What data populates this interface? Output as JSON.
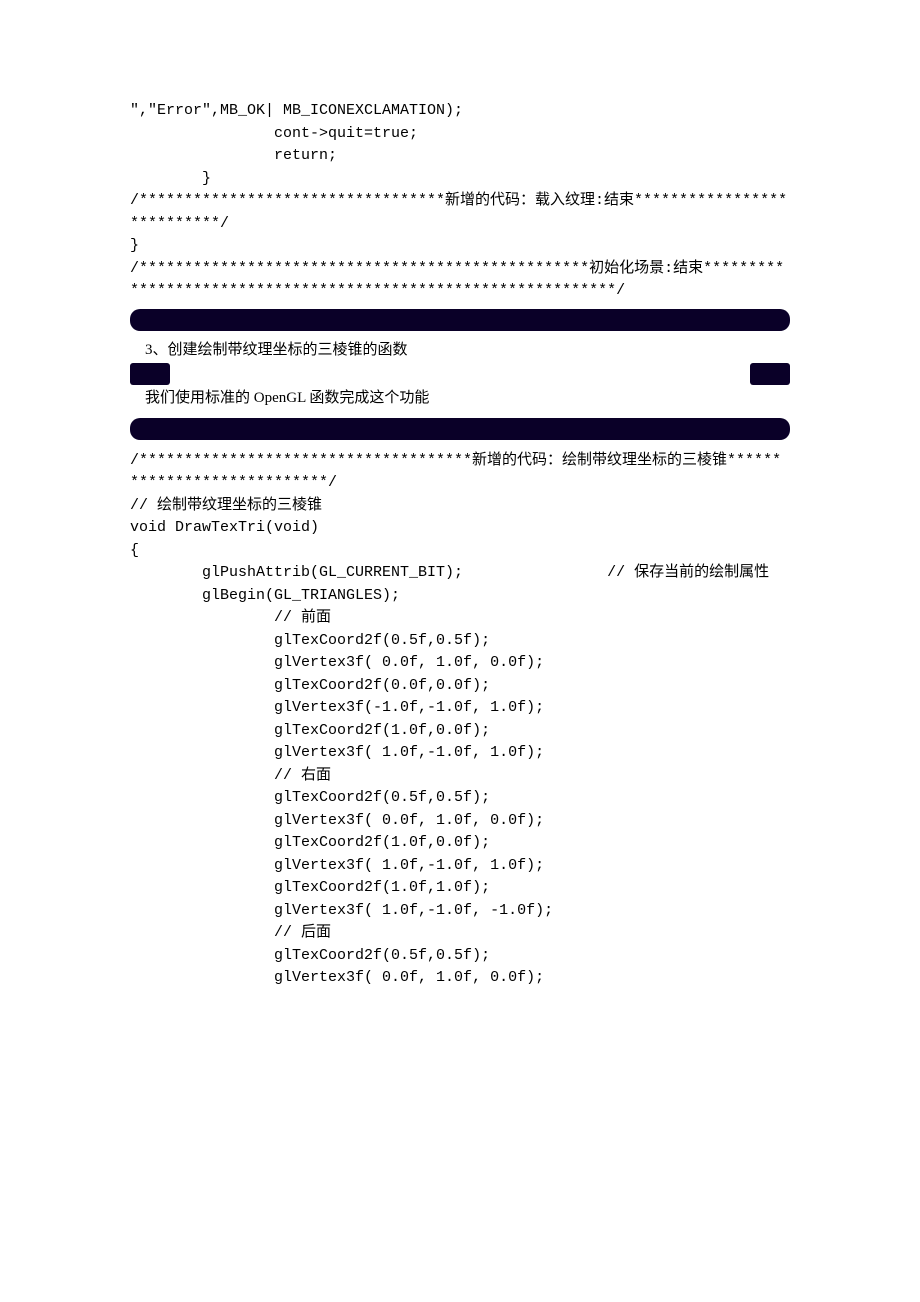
{
  "code_block_1": {
    "l1": "\",\"Error\",MB_OK| MB_ICONEXCLAMATION);",
    "l2": "                cont->quit=true;",
    "l3": "                return;",
    "l4": "        }",
    "l5": "/**********************************新增的代码：载入纹理:结束***************************/",
    "l6": "}",
    "l7": "/**************************************************初始化场景:结束***************************************************************/"
  },
  "prose": {
    "p1": "3、创建绘制带纹理坐标的三棱锥的函数",
    "p2": "我们使用标准的 OpenGL 函数完成这个功能"
  },
  "code_block_2": {
    "l1": "/*************************************新增的代码：绘制带纹理坐标的三棱锥****************************/",
    "l2": "// 绘制带纹理坐标的三棱锥",
    "l3": "void DrawTexTri(void)",
    "l4": "{",
    "l5": "        glPushAttrib(GL_CURRENT_BIT);                // 保存当前的绘制属性",
    "l6": "        glBegin(GL_TRIANGLES);",
    "l7": "                // 前面",
    "l8": "                glTexCoord2f(0.5f,0.5f);",
    "l9": "                glVertex3f( 0.0f, 1.0f, 0.0f);",
    "l10": "                glTexCoord2f(0.0f,0.0f);",
    "l11": "                glVertex3f(-1.0f,-1.0f, 1.0f);",
    "l12": "                glTexCoord2f(1.0f,0.0f);",
    "l13": "                glVertex3f( 1.0f,-1.0f, 1.0f);",
    "l14": "",
    "l15": "                // 右面",
    "l16": "                glTexCoord2f(0.5f,0.5f);",
    "l17": "                glVertex3f( 0.0f, 1.0f, 0.0f);",
    "l18": "                glTexCoord2f(1.0f,0.0f);",
    "l19": "                glVertex3f( 1.0f,-1.0f, 1.0f);",
    "l20": "                glTexCoord2f(1.0f,1.0f);",
    "l21": "                glVertex3f( 1.0f,-1.0f, -1.0f);",
    "l22": "",
    "l23": "                // 后面",
    "l24": "                glTexCoord2f(0.5f,0.5f);",
    "l25": "                glVertex3f( 0.0f, 1.0f, 0.0f);"
  }
}
